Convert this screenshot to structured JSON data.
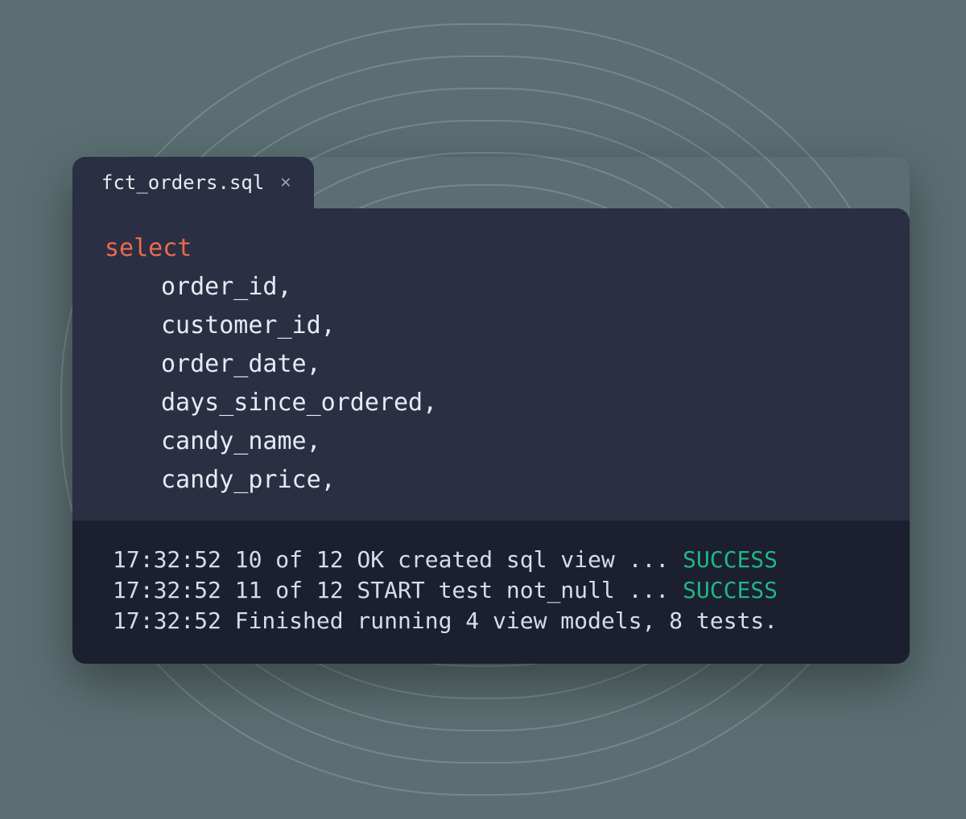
{
  "tab": {
    "filename": "fct_orders.sql"
  },
  "code": {
    "keyword": "select",
    "columns": [
      "order_id,",
      "customer_id,",
      "order_date,",
      "days_since_ordered,",
      "candy_name,",
      "candy_price,"
    ]
  },
  "terminal": {
    "lines": [
      {
        "prefix": "17:32:52 10 of 12 OK created sql view ... ",
        "status": "SUCCESS"
      },
      {
        "prefix": "17:32:52 11 of 12 START test not_null ... ",
        "status": "SUCCESS"
      },
      {
        "prefix": "17:32:52 Finished running 4 view models, 8 tests.",
        "status": ""
      }
    ]
  }
}
